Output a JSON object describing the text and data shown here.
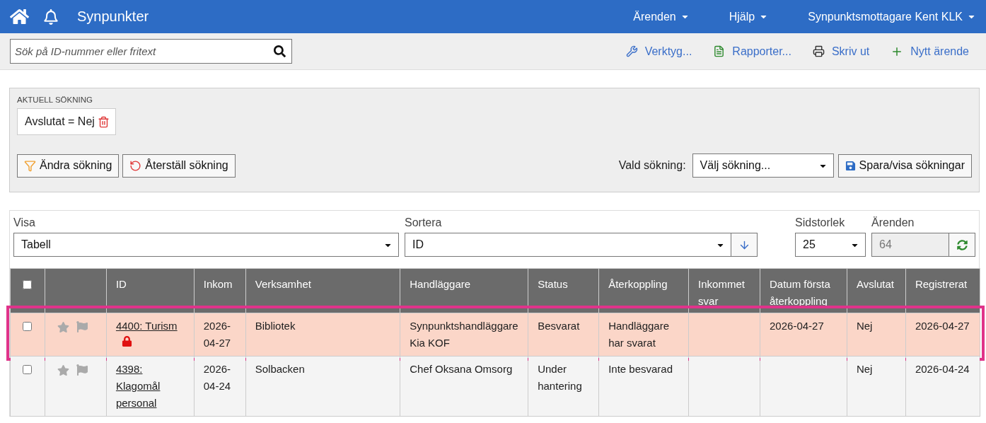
{
  "header": {
    "title": "Synpunkter",
    "menus": [
      {
        "label": "Ärenden"
      },
      {
        "label": "Hjälp"
      },
      {
        "label": "Synpunktsmottagare Kent KLK"
      }
    ]
  },
  "toolbar": {
    "search": {
      "placeholder": "Sök på ID-nummer eller fritext"
    },
    "actions": [
      {
        "kind": "tools",
        "label": "Verktyg..."
      },
      {
        "kind": "reports",
        "label": "Rapporter..."
      },
      {
        "kind": "print",
        "label": "Skriv ut"
      },
      {
        "kind": "new",
        "label": "Nytt ärende"
      }
    ]
  },
  "current_search": {
    "heading": "AKTUELL SÖKNING",
    "filters": [
      {
        "label": "Avslutat = Nej"
      }
    ],
    "buttons": [
      {
        "kind": "edit",
        "label": "Ändra sökning"
      },
      {
        "kind": "reset",
        "label": "Återställ sökning"
      }
    ],
    "saved": {
      "label": "Vald sökning:",
      "value": "Välj sökning...",
      "button": "Spara/visa sökningar"
    }
  },
  "list": {
    "view": {
      "label": "Visa",
      "value": "Tabell"
    },
    "sort": {
      "label": "Sortera",
      "value": "ID"
    },
    "page_size": {
      "label": "Sidstorlek",
      "value": "25"
    },
    "count": {
      "label": "Ärenden",
      "value": "64"
    }
  },
  "table": {
    "all_checked": false,
    "columns": [
      "ID",
      "Inkom",
      "Verksamhet",
      "Handläggare",
      "Status",
      "Återkoppling",
      "Inkommet svar",
      "Datum första återkoppling",
      "Avslutat",
      "Registrerat"
    ],
    "rows": [
      {
        "checked": false,
        "starred": false,
        "flagged": false,
        "locked": true,
        "highlighted": true,
        "cells": [
          "4400: Turism",
          "2026-04-27",
          "Bibliotek",
          "Synpunktshandläggare Kia KOF",
          "Besvarat",
          "Handläggare har svarat",
          "",
          "2026-04-27",
          "Nej",
          "2026-04-27"
        ]
      },
      {
        "checked": false,
        "starred": false,
        "flagged": false,
        "locked": false,
        "highlighted": false,
        "cells": [
          "4398: Klagomål personal",
          "2026-04-24",
          "Solbacken",
          "Chef Oksana Omsorg",
          "Under hantering",
          "Inte besvarad",
          "",
          "",
          "Nej",
          "2026-04-24"
        ]
      }
    ]
  }
}
